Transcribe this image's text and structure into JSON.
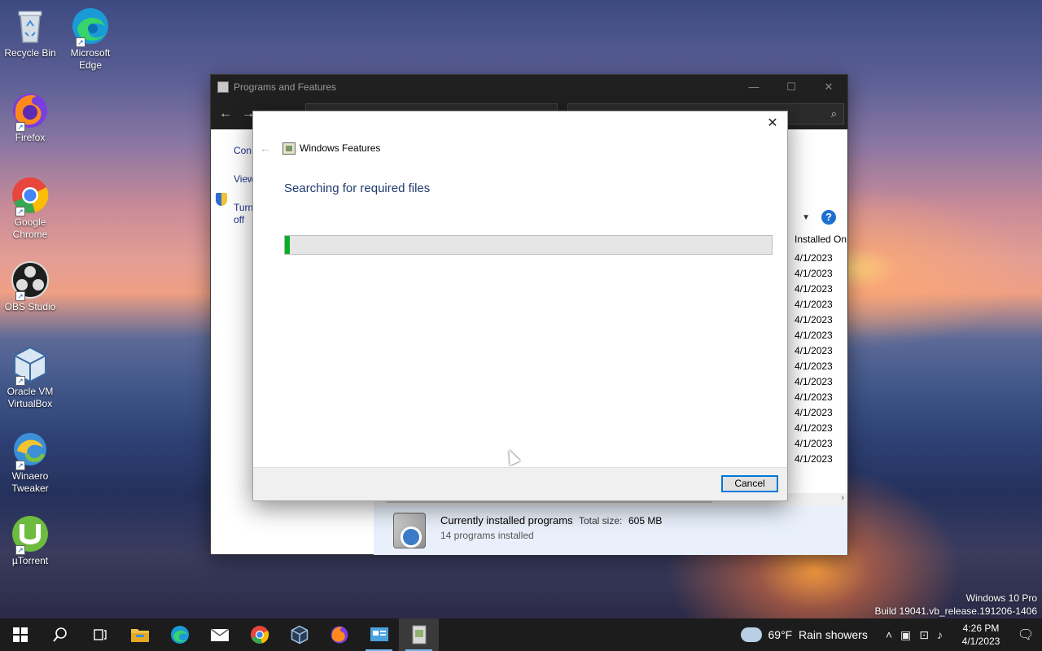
{
  "desktop": {
    "icons": [
      {
        "label_line1": "Recycle Bin",
        "label_line2": "",
        "icon": "recycle-bin-icon",
        "color": "#cfd8e3"
      },
      {
        "label_line1": "Microsoft",
        "label_line2": "Edge",
        "icon": "edge-icon",
        "color": "#1fa4d6"
      },
      {
        "label_line1": "Firefox",
        "label_line2": "",
        "icon": "firefox-icon",
        "color": "#ff7a1a"
      },
      {
        "label_line1": "Google",
        "label_line2": "Chrome",
        "icon": "chrome-icon",
        "color": "#e8453c"
      },
      {
        "label_line1": "OBS Studio",
        "label_line2": "",
        "icon": "obs-icon",
        "color": "#2b2b2b"
      },
      {
        "label_line1": "Oracle VM",
        "label_line2": "VirtualBox",
        "icon": "virtualbox-icon",
        "color": "#1b5e9e"
      },
      {
        "label_line1": "Winaero",
        "label_line2": "Tweaker",
        "icon": "winaero-tweaker-icon",
        "color": "#3b8fd9"
      },
      {
        "label_line1": "µTorrent",
        "label_line2": "",
        "icon": "utorrent-icon",
        "color": "#6dbb3f"
      }
    ],
    "watermark_line1": "Windows 10 Pro",
    "watermark_line2": "Build 19041.vb_release.191206-1406"
  },
  "programs_window": {
    "title": "Programs and Features",
    "left_links": [
      "Con",
      "View",
      "Turn",
      "off"
    ],
    "column_installed_on": "Installed On",
    "dates": [
      "4/1/2023",
      "4/1/2023",
      "4/1/2023",
      "4/1/2023",
      "4/1/2023",
      "4/1/2023",
      "4/1/2023",
      "4/1/2023",
      "4/1/2023",
      "4/1/2023",
      "4/1/2023",
      "4/1/2023",
      "4/1/2023",
      "4/1/2023"
    ],
    "status": {
      "title": "Currently installed programs",
      "total_size_label": "Total size:",
      "total_size": "605 MB",
      "count": "14 programs installed"
    }
  },
  "features_dialog": {
    "title": "Windows Features",
    "heading": "Searching for required files",
    "progress_percent": 1,
    "cancel_label": "Cancel"
  },
  "taskbar": {
    "items": [
      {
        "name": "start-button",
        "icon": "windows-logo-icon"
      },
      {
        "name": "search-button",
        "icon": "search-icon"
      },
      {
        "name": "task-view-button",
        "icon": "task-view-icon"
      },
      {
        "name": "file-explorer-button",
        "icon": "folder-icon",
        "color": "#f0c24a"
      },
      {
        "name": "edge-taskbar-button",
        "icon": "edge-icon",
        "color": "#1fa4d6"
      },
      {
        "name": "mail-taskbar-button",
        "icon": "mail-icon",
        "color": "#e6e6e6"
      },
      {
        "name": "chrome-taskbar-button",
        "icon": "chrome-icon",
        "color": "#e8453c"
      },
      {
        "name": "virtualbox-taskbar-button",
        "icon": "virtualbox-icon",
        "color": "#9ec4e8"
      },
      {
        "name": "firefox-taskbar-button",
        "icon": "firefox-icon",
        "color": "#ff7a1a"
      },
      {
        "name": "control-panel-taskbar-button",
        "icon": "control-panel-icon",
        "color": "#4aa3df"
      },
      {
        "name": "windows-features-taskbar-button",
        "icon": "windows-features-icon",
        "color": "#d9d9d9"
      }
    ],
    "weather": "69°F  Rain showers",
    "time": "4:26 PM",
    "date": "4/1/2023",
    "tray_icons": [
      "chevron-up-icon",
      "meet-now-icon",
      "network-icon",
      "volume-icon"
    ]
  }
}
